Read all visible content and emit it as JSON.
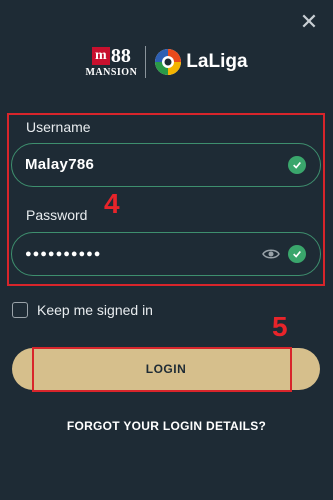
{
  "header": {
    "close_icon": "close-icon",
    "brand": {
      "box_letter": "m",
      "number": "88",
      "subtitle": "MANSION"
    },
    "partner": {
      "name": "LaLiga"
    }
  },
  "form": {
    "username_label": "Username",
    "username_value": "Malay786",
    "password_label": "Password",
    "password_value": "●●●●●●●●●●",
    "keep_signed_in_label": "Keep me signed in",
    "keep_signed_in_checked": false,
    "login_label": "LOGIN",
    "forgot_label": "FORGOT YOUR LOGIN DETAILS?"
  },
  "annotations": {
    "step_fields": "4",
    "step_login": "5"
  },
  "colors": {
    "background": "#1e2b35",
    "field_border": "#3e8f6e",
    "check_green": "#3aa66c",
    "login_button": "#d6bf8c",
    "annotation_red": "#d8252b",
    "brand_red": "#c8102e"
  }
}
